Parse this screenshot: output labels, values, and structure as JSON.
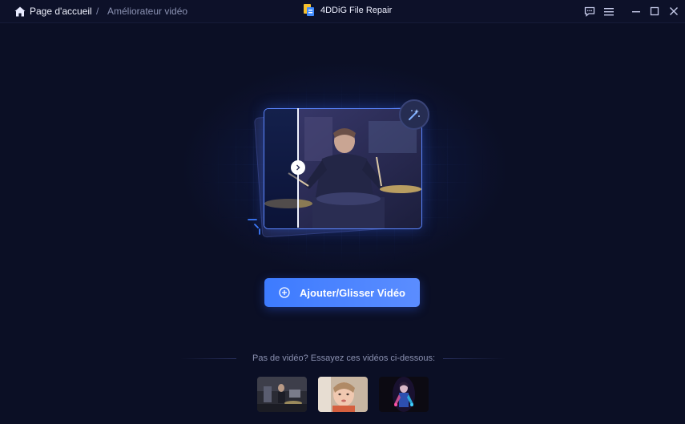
{
  "titlebar": {
    "home_label": "Page d'accueil",
    "separator": "/",
    "current_page": "Améliorateur vidéo",
    "app_title": "4DDiG File Repair",
    "icons": [
      "home-icon",
      "app-logo-icon",
      "feedback-icon",
      "menu-icon",
      "minimize-icon",
      "maximize-icon",
      "close-icon"
    ]
  },
  "main": {
    "add_button_label": "Ajouter/Glisser Vidéo",
    "add_button_icon": "plus-circle-icon",
    "sample_prompt": "Pas de vidéo? Essayez ces vidéos ci-dessous:",
    "sample_videos": [
      "sample-video-concert",
      "sample-video-child",
      "sample-video-neon-figure"
    ]
  },
  "colors": {
    "background": "#0b0f25",
    "accent": "#4a85ff",
    "titlebar": "#0d1129"
  }
}
